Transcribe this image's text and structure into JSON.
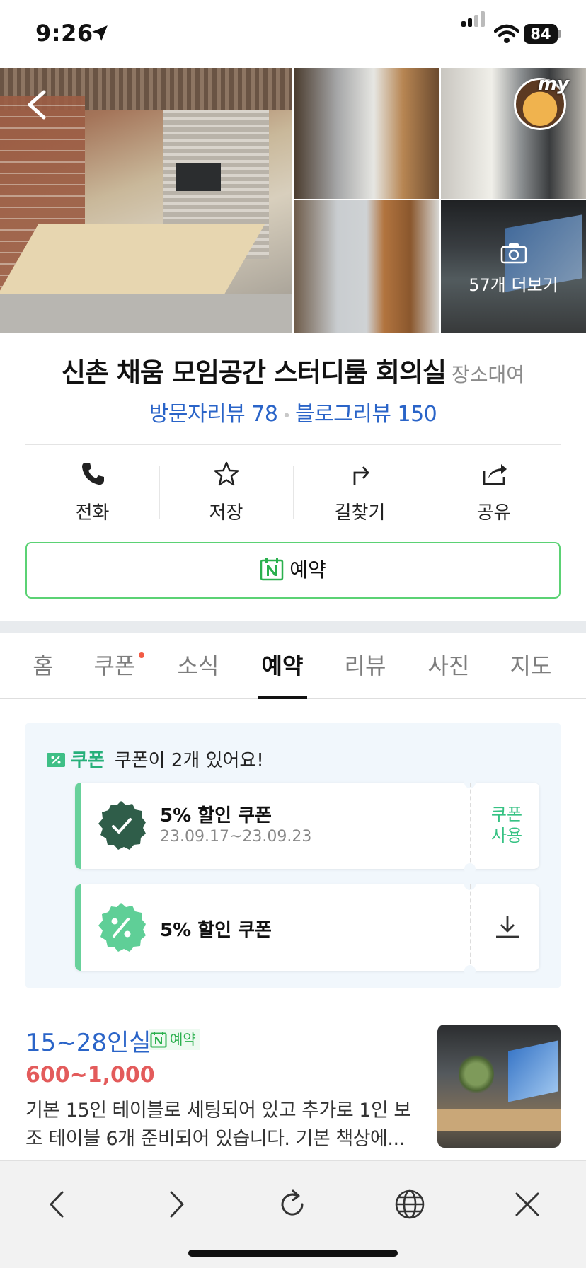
{
  "status_bar": {
    "time": "9:26",
    "battery": "84"
  },
  "gallery": {
    "more_photos_label": "57개 더보기",
    "avatar_text": "my"
  },
  "place": {
    "name": "신촌 채움 모임공간 스터디룸 회의실",
    "category": "장소대여",
    "visitor_reviews": "방문자리뷰 78",
    "blog_reviews": "블로그리뷰 150"
  },
  "actions": [
    {
      "label": "전화",
      "icon": "phone-icon"
    },
    {
      "label": "저장",
      "icon": "star-icon"
    },
    {
      "label": "길찾기",
      "icon": "directions-icon"
    },
    {
      "label": "공유",
      "icon": "share-icon"
    }
  ],
  "reserve_button": {
    "label": "예약"
  },
  "tabs": [
    {
      "label": "홈"
    },
    {
      "label": "쿠폰"
    },
    {
      "label": "소식"
    },
    {
      "label": "예약"
    },
    {
      "label": "리뷰"
    },
    {
      "label": "사진"
    },
    {
      "label": "지도"
    }
  ],
  "active_tab": "예약",
  "coupons": {
    "tag": "쿠폰",
    "summary": "쿠폰이 2개 있어요!",
    "items": [
      {
        "name": "5% 할인 쿠폰",
        "dates": "23.09.17~23.09.23",
        "action": "쿠폰\n사용"
      },
      {
        "name": "5% 할인 쿠폰",
        "action_icon": "download-icon"
      }
    ]
  },
  "room": {
    "name": "15~28인실",
    "badge": "예약",
    "price": "600~1,000",
    "description": "기본 15인 테이블로 세팅되어 있고 추가로 1인 보조 테이블 6개 준비되어 있습니다. 기본 책상에..."
  },
  "colors": {
    "link_blue": "#2a64c8",
    "naver_green": "#5bd274",
    "coupon_green": "#27b07a",
    "price_red": "#e35b5b"
  }
}
